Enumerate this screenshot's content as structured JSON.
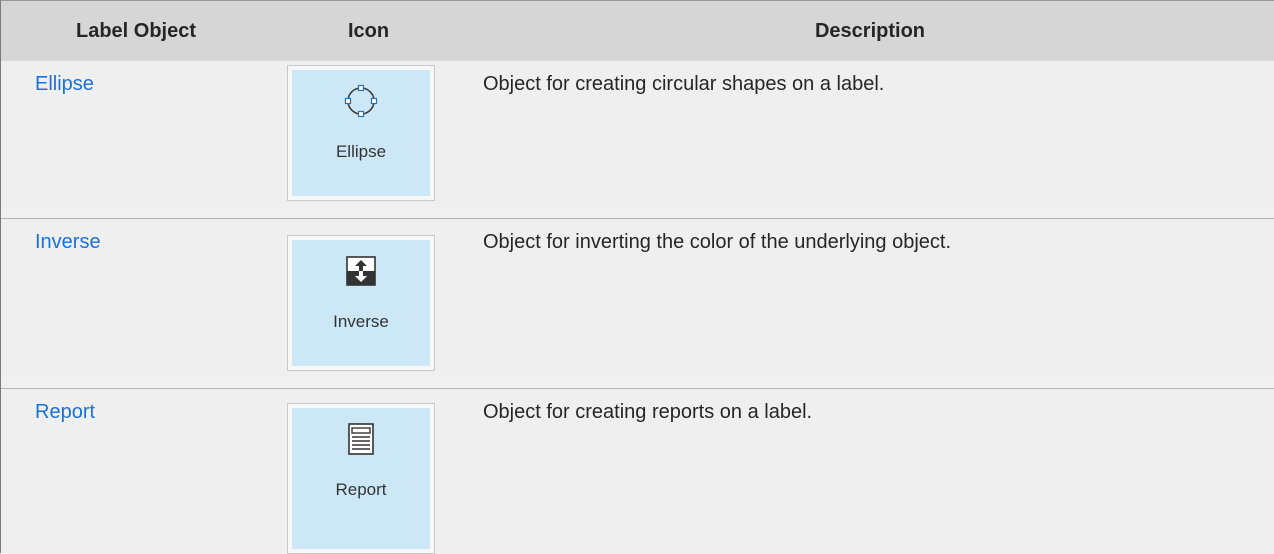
{
  "table": {
    "headers": {
      "label_object": "Label Object",
      "icon": "Icon",
      "description": "Description"
    },
    "rows": [
      {
        "name": "Ellipse",
        "icon": "ellipse-icon",
        "icon_caption": "Ellipse",
        "description": "Object for creating circular shapes on a label."
      },
      {
        "name": "Inverse",
        "icon": "inverse-icon",
        "icon_caption": "Inverse",
        "description": "Object for inverting the color of the underlying object."
      },
      {
        "name": "Report",
        "icon": "report-icon",
        "icon_caption": "Report",
        "description": "Object for creating reports on a label."
      }
    ]
  },
  "colors": {
    "header_bg": "#d6d6d6",
    "row_bg": "#efefef",
    "link": "#1a72d9",
    "icon_tile": "#cce8f6"
  }
}
